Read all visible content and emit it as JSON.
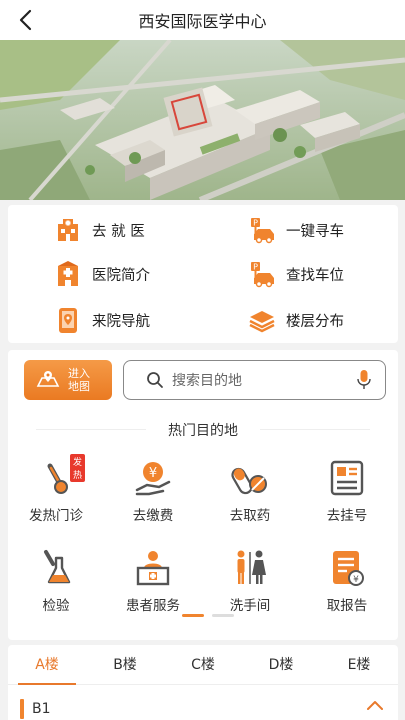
{
  "header": {
    "title": "西安国际医学中心"
  },
  "services": [
    {
      "label": "去 就 医",
      "icon": "hospital-icon"
    },
    {
      "label": "一键寻车",
      "icon": "car-search-icon"
    },
    {
      "label": "医院简介",
      "icon": "hospital-intro-icon"
    },
    {
      "label": "查找车位",
      "icon": "parking-icon"
    },
    {
      "label": "来院导航",
      "icon": "navigation-icon"
    },
    {
      "label": "楼层分布",
      "icon": "layers-icon"
    }
  ],
  "map": {
    "enter_label_1": "进入",
    "enter_label_2": "地图"
  },
  "search": {
    "placeholder": "搜索目的地"
  },
  "hot": {
    "title": "热门目的地",
    "badge": "发热",
    "items": [
      {
        "label": "发热门诊",
        "icon": "thermometer-icon"
      },
      {
        "label": "去缴费",
        "icon": "payment-icon"
      },
      {
        "label": "去取药",
        "icon": "medicine-icon"
      },
      {
        "label": "去挂号",
        "icon": "registration-icon"
      },
      {
        "label": "检验",
        "icon": "lab-flask-icon"
      },
      {
        "label": "患者服务",
        "icon": "service-desk-icon"
      },
      {
        "label": "洗手间",
        "icon": "restroom-icon"
      },
      {
        "label": "取报告",
        "icon": "report-icon"
      }
    ]
  },
  "floors": {
    "tabs": [
      "A楼",
      "B楼",
      "C楼",
      "D楼",
      "E楼"
    ],
    "active_tab": "A楼",
    "current_floor": "B1"
  },
  "colors": {
    "accent": "#f0842e",
    "accent_dark": "#e8792c"
  }
}
